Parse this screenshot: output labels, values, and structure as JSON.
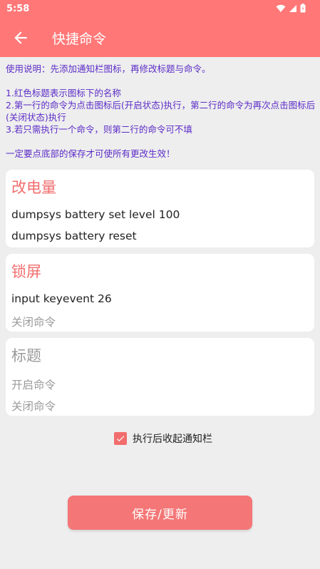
{
  "status_bar": {
    "time": "5:58",
    "icons": [
      "wifi-icon",
      "signal-icon",
      "battery-icon"
    ]
  },
  "app_bar": {
    "back_icon": "arrow-left-icon",
    "title": "快捷命令"
  },
  "instructions": {
    "intro": "使用说明：先添加通知栏图标，再修改标题与命令。",
    "rules": [
      "1.红色标题表示图标下的名称",
      "2.第一行的命令为点击图标后(开启状态)执行，第二行的命令为再次点击图标后(关闭状态)执行",
      "3.若只需执行一个命令，则第二行的命令可不填"
    ],
    "warning": "一定要点底部的保存才可使所有更改生效！"
  },
  "cards": [
    {
      "title": "改电量",
      "on_command": "dumpsys battery set level 100",
      "off_command": "dumpsys battery reset"
    },
    {
      "title": "锁屏",
      "on_command": "input keyevent 26",
      "off_command": "关闭命令"
    },
    {
      "title": "标题",
      "on_command": "开启命令",
      "off_command": "关闭命令"
    }
  ],
  "collapse_checkbox": {
    "label": "执行后收起通知栏",
    "checked": true
  },
  "save_button": {
    "label": "保存/更新"
  },
  "colors": {
    "primary": "#ff7777",
    "title_red": "#f26d6d",
    "instruction_text": "#5b2cc7",
    "placeholder_gray": "#9a9a9a"
  }
}
